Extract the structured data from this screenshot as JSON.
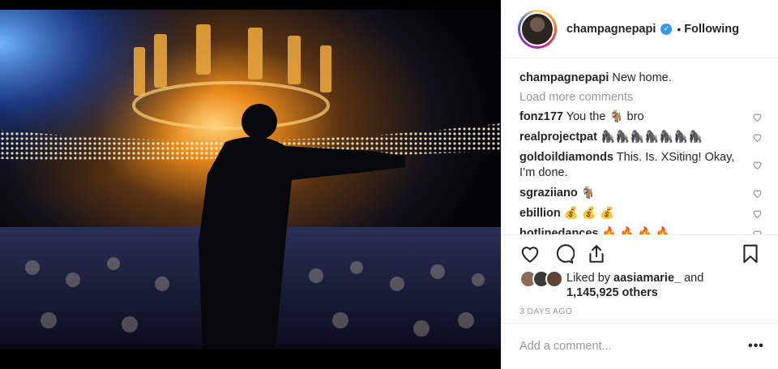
{
  "post": {
    "username": "champagnepapi",
    "verified": true,
    "follow_status": "Following",
    "caption_user": "champagnepapi",
    "caption_text": "New home.",
    "load_more": "Load more comments"
  },
  "comments": [
    {
      "user": "fonz177",
      "text": "You the 🐐 bro"
    },
    {
      "user": "realprojectpat",
      "text": "🦍🦍🦍🦍🦍🦍🦍"
    },
    {
      "user": "goldoildiamonds",
      "text": "This. Is. XSiting! Okay, I’m done."
    },
    {
      "user": "sgraziiano",
      "text": "🐐"
    },
    {
      "user": "ebillion",
      "text": "💰 💰 💰"
    },
    {
      "user": "hotlinedances",
      "text": "🔥 🔥 🔥 🔥"
    }
  ],
  "likes": {
    "prefix": "Liked by ",
    "liked_by_user": "aasiamarie_",
    "conjunction": " and",
    "others": "1,145,925 others"
  },
  "time_ago": "3 DAYS AGO",
  "add_comment": {
    "placeholder": "Add a comment..."
  },
  "more_options": "•••",
  "icons": {
    "like": "heart-icon",
    "comment": "comment-bubble-icon",
    "share": "share-icon",
    "save": "bookmark-icon",
    "verified": "verified-badge-icon"
  },
  "colors": {
    "verified_blue": "#3897f0",
    "muted_text": "#999999",
    "divider": "#efefef"
  }
}
